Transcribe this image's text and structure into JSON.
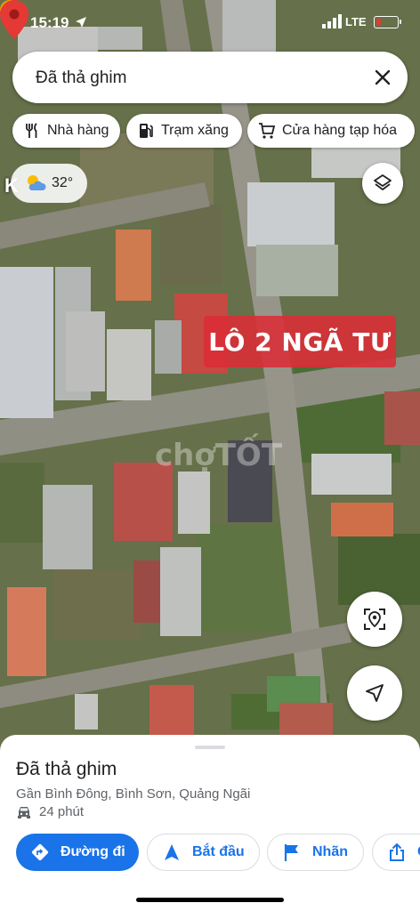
{
  "status_bar": {
    "time": "15:19",
    "network": "LTE",
    "location_icon": "location-arrow-icon",
    "signal_icon": "cellular-signal-icon",
    "battery_icon": "battery-low-icon"
  },
  "search": {
    "value": "Đã thả ghim",
    "close_icon": "close-icon"
  },
  "chips": [
    {
      "label": "Nhà hàng",
      "icon": "restaurant-icon"
    },
    {
      "label": "Trạm xăng",
      "icon": "gas-station-icon"
    },
    {
      "label": "Cửa hàng tạp hóa",
      "icon": "shopping-cart-icon"
    }
  ],
  "weather": {
    "temperature": "32°",
    "icon": "partly-sunny-icon"
  },
  "map": {
    "edge_label": "K",
    "banner_text": "LÔ 2 NGÃ TƯ",
    "watermark": "chợTỐT",
    "pin_color": "#e53935",
    "banner_color": "#dc2c36",
    "layers_icon": "layers-icon",
    "locate_place_icon": "locate-place-icon",
    "my_location_icon": "navigation-arrow-icon"
  },
  "sheet": {
    "title": "Đã thả ghim",
    "address": "Gần Bình Đông, Bình Sơn, Quảng Ngãi",
    "eta": "24 phút",
    "eta_icon": "car-icon",
    "actions": [
      {
        "label": "Đường đi",
        "icon": "directions-icon"
      },
      {
        "label": "Bắt đầu",
        "icon": "navigation-icon"
      },
      {
        "label": "Nhãn",
        "icon": "flag-icon"
      },
      {
        "label": "C",
        "icon": "share-icon"
      }
    ]
  },
  "colors": {
    "accent": "#1a73e8",
    "text": "#202124",
    "secondary_text": "#5f6368"
  }
}
